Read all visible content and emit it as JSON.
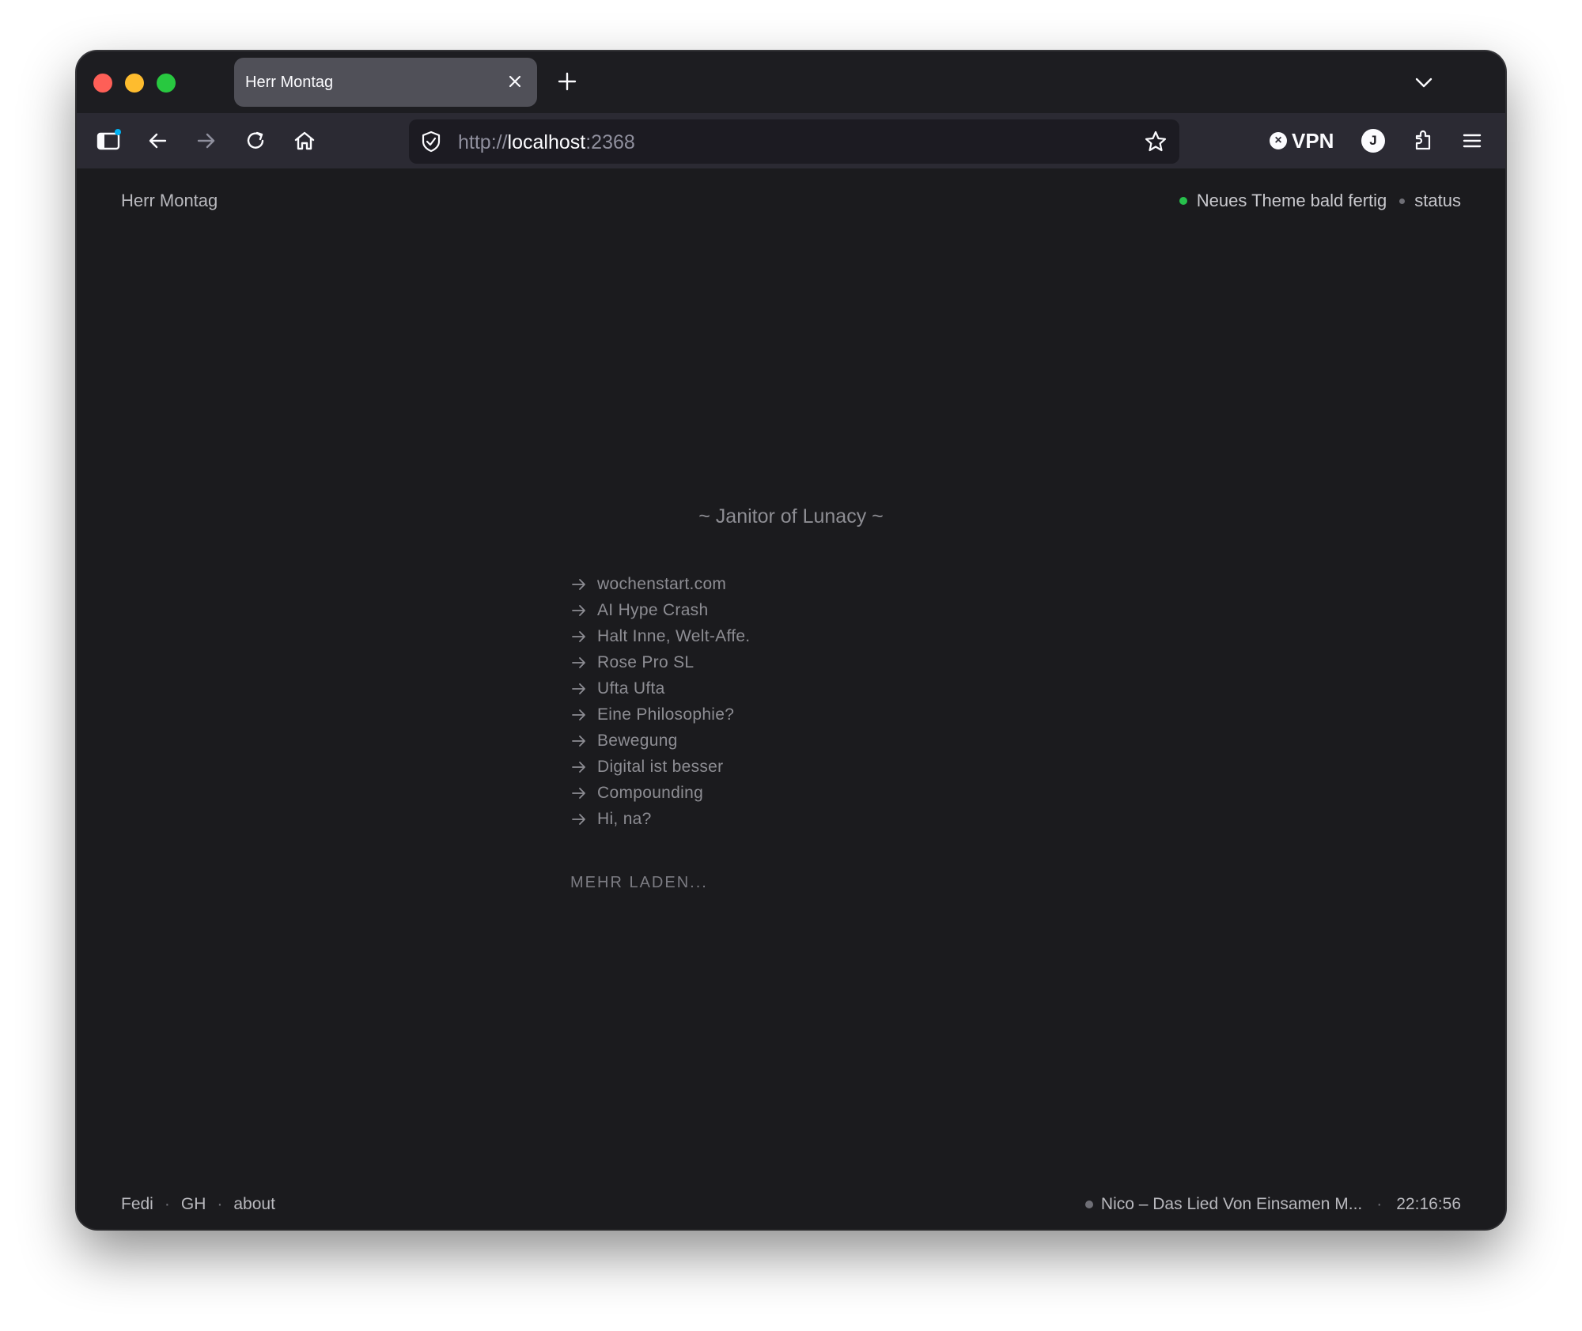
{
  "browser": {
    "tab_title": "Herr Montag",
    "url_scheme": "http://",
    "url_host": "localhost",
    "url_port": ":2368",
    "vpn_label": "VPN",
    "avatar_initial": "J"
  },
  "site": {
    "title": "Herr Montag",
    "status_message": "Neues Theme bald fertig",
    "status_link": "status",
    "tagline": "~ Janitor of Lunacy ~",
    "posts": [
      "wochenstart.com",
      "AI Hype Crash",
      "Halt Inne, Welt-Affe.",
      "Rose Pro SL",
      "Ufta Ufta",
      "Eine Philosophie?",
      "Bewegung",
      "Digital ist besser",
      "Compounding",
      "Hi, na?"
    ],
    "load_more": "MEHR LADEN...",
    "footer_links": [
      "Fedi",
      "GH",
      "about"
    ],
    "now_playing": "Nico – Das Lied Von Einsamen M...",
    "clock": "22:16:56"
  },
  "colors": {
    "status_dot": "#27c04c",
    "page_bg": "#1b1b1e",
    "toolbar_bg": "#2b2a33"
  }
}
